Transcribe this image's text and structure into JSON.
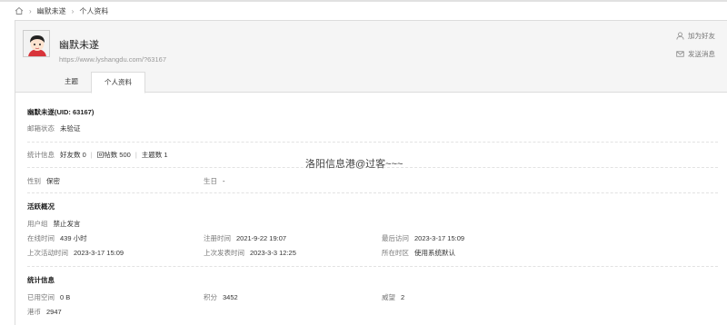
{
  "breadcrumb": {
    "user": "幽默未遂",
    "page": "个人资料",
    "separator": "›"
  },
  "profile": {
    "username": "幽默未遂",
    "url": "https://www.lyshangdu.com/?63167",
    "add_friend": "加为好友",
    "send_message": "发送消息"
  },
  "tabs": [
    {
      "label": "主题",
      "active": false
    },
    {
      "label": "个人资料",
      "active": true
    }
  ],
  "info": {
    "uid_line": "幽默未遂(UID: 63167)",
    "email_label": "邮箱状态",
    "email_value": "未验证",
    "stats_label": "统计信息",
    "friends": "好友数 0",
    "replies": "回帖数 500",
    "topics": "主题数 1",
    "gender_label": "性别",
    "gender_value": "保密",
    "birthday_label": "生日",
    "birthday_value": "-"
  },
  "activity": {
    "title": "活跃概况",
    "group_label": "用户组",
    "group_value": "禁止发言",
    "online_label": "在线时间",
    "online_value": "439 小时",
    "register_label": "注册时间",
    "register_value": "2021-9-22 19:07",
    "last_visit_label": "最后访问",
    "last_visit_value": "2023-3-17 15:09",
    "last_active_label": "上次活动时间",
    "last_active_value": "2023-3-17 15:09",
    "last_post_label": "上次发表时间",
    "last_post_value": "2023-3-3 12:25",
    "timezone_label": "所在时区",
    "timezone_value": "使用系统默认"
  },
  "statistics": {
    "title": "统计信息",
    "space_label": "已用空间",
    "space_value": "0 B",
    "points_label": "积分",
    "points_value": "3452",
    "prestige_label": "威望",
    "prestige_value": "2",
    "coins_label": "港币",
    "coins_value": "2947"
  },
  "watermark": "洛阳信息港@过客~~~",
  "colors": {
    "header_bg": "#f5f5f5",
    "border": "#dcdcdc",
    "label": "#777777"
  }
}
